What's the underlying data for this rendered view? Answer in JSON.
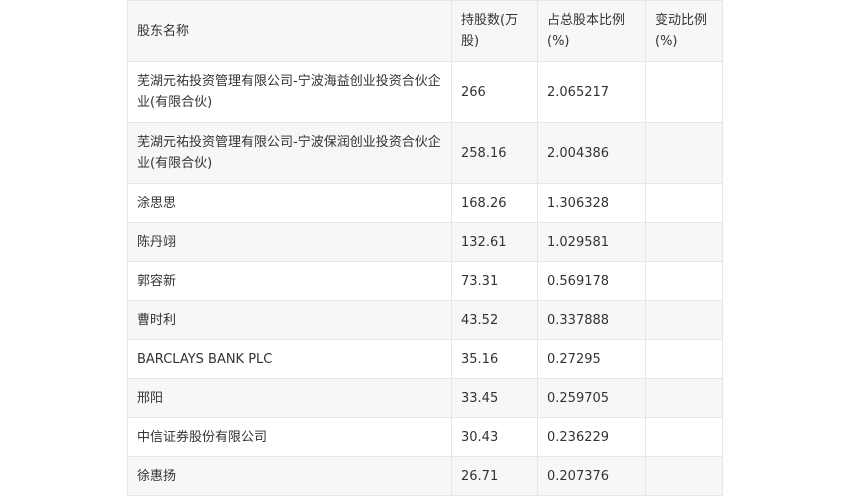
{
  "table": {
    "headers": {
      "name": "股东名称",
      "shares": "持股数(万股)",
      "ratio": "占总股本比例(%)",
      "change": "变动比例(%)"
    },
    "rows": [
      {
        "name": "芜湖元祐投资管理有限公司-宁波海益创业投资合伙企业(有限合伙)",
        "shares": "266",
        "ratio": "2.065217",
        "change": ""
      },
      {
        "name": "芜湖元祐投资管理有限公司-宁波保润创业投资合伙企业(有限合伙)",
        "shares": "258.16",
        "ratio": "2.004386",
        "change": ""
      },
      {
        "name": "涂思思",
        "shares": "168.26",
        "ratio": "1.306328",
        "change": ""
      },
      {
        "name": "陈丹翊",
        "shares": "132.61",
        "ratio": "1.029581",
        "change": ""
      },
      {
        "name": "郭容新",
        "shares": "73.31",
        "ratio": "0.569178",
        "change": ""
      },
      {
        "name": "曹时利",
        "shares": "43.52",
        "ratio": "0.337888",
        "change": ""
      },
      {
        "name": "BARCLAYS BANK PLC",
        "shares": "35.16",
        "ratio": "0.27295",
        "change": ""
      },
      {
        "name": "邢阳",
        "shares": "33.45",
        "ratio": "0.259705",
        "change": ""
      },
      {
        "name": "中信证券股份有限公司",
        "shares": "30.43",
        "ratio": "0.236229",
        "change": ""
      },
      {
        "name": "徐惠扬",
        "shares": "26.71",
        "ratio": "0.207376",
        "change": ""
      }
    ]
  }
}
